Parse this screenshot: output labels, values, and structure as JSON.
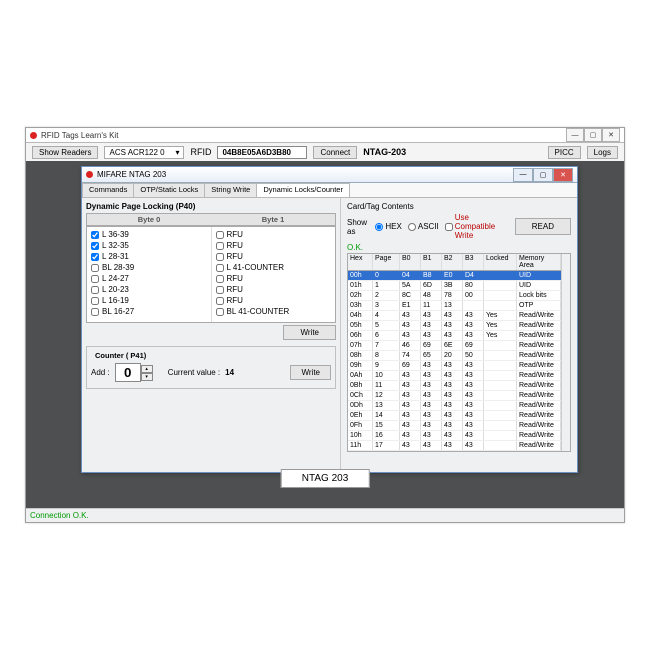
{
  "app": {
    "title": "RFID Tags Learn's Kit",
    "win_min": "—",
    "win_max": "▢",
    "win_close": "✕"
  },
  "toolbar": {
    "show_readers": "Show Readers",
    "reader_selected": "ACS ACR122 0",
    "rfid_label": "RFID",
    "rfid_value": "04B8E05A6D3B80",
    "connect": "Connect",
    "tag_name": "NTAG-203",
    "picc": "PICC",
    "logs": "Logs"
  },
  "canvas_label": "NTAG 203",
  "status": "Connection O.K.",
  "child": {
    "title": "MIFARE NTAG 203",
    "tabs": [
      "Commands",
      "OTP/Static Locks",
      "String Write",
      "Dynamic Locks/Counter"
    ],
    "active_tab": 3,
    "dpl_title": "Dynamic Page Locking (P40)",
    "byte0_label": "Byte 0",
    "byte1_label": "Byte 1",
    "byte0_items": [
      {
        "label": "L 36-39",
        "checked": true
      },
      {
        "label": "L 32-35",
        "checked": true
      },
      {
        "label": "L 28-31",
        "checked": true
      },
      {
        "label": "BL 28-39",
        "checked": false
      },
      {
        "label": "L 24-27",
        "checked": false
      },
      {
        "label": "L 20-23",
        "checked": false
      },
      {
        "label": "L 16-19",
        "checked": false
      },
      {
        "label": "BL 16-27",
        "checked": false
      }
    ],
    "byte1_items": [
      {
        "label": "RFU",
        "checked": false
      },
      {
        "label": "RFU",
        "checked": false
      },
      {
        "label": "RFU",
        "checked": false
      },
      {
        "label": "L 41-COUNTER",
        "checked": false
      },
      {
        "label": "RFU",
        "checked": false
      },
      {
        "label": "RFU",
        "checked": false
      },
      {
        "label": "RFU",
        "checked": false
      },
      {
        "label": "BL 41-COUNTER",
        "checked": false
      }
    ],
    "write": "Write",
    "counter": {
      "group": "Counter ( P41)",
      "add_label": "Add :",
      "add_value": "0",
      "cur_label": "Current value :",
      "cur_value": "14"
    },
    "contents_title": "Card/Tag Contents",
    "show_as": "Show as",
    "hex": "HEX",
    "ascii": "ASCII",
    "compat": "Use Compatible Write",
    "read": "READ",
    "ok": "O.K.",
    "grid_head": [
      "Hex",
      "Page",
      "B0",
      "B1",
      "B2",
      "B3",
      "Locked",
      "Memory Area"
    ],
    "rows": [
      {
        "h": "00h",
        "p": "0",
        "b": [
          "04",
          "B8",
          "E0",
          "D4"
        ],
        "l": "",
        "m": "UID",
        "sel": true
      },
      {
        "h": "01h",
        "p": "1",
        "b": [
          "5A",
          "6D",
          "3B",
          "80"
        ],
        "l": "",
        "m": "UID"
      },
      {
        "h": "02h",
        "p": "2",
        "b": [
          "8C",
          "48",
          "78",
          "00"
        ],
        "l": "",
        "m": "Lock bits"
      },
      {
        "h": "03h",
        "p": "3",
        "b": [
          "E1",
          "11",
          "13",
          ""
        ],
        "l": "",
        "m": "OTP"
      },
      {
        "h": "04h",
        "p": "4",
        "b": [
          "43",
          "43",
          "43",
          "43"
        ],
        "l": "Yes",
        "m": "Read/Write"
      },
      {
        "h": "05h",
        "p": "5",
        "b": [
          "43",
          "43",
          "43",
          "43"
        ],
        "l": "Yes",
        "m": "Read/Write"
      },
      {
        "h": "06h",
        "p": "6",
        "b": [
          "43",
          "43",
          "43",
          "43"
        ],
        "l": "Yes",
        "m": "Read/Write"
      },
      {
        "h": "07h",
        "p": "7",
        "b": [
          "46",
          "69",
          "6E",
          "69"
        ],
        "l": "",
        "m": "Read/Write"
      },
      {
        "h": "08h",
        "p": "8",
        "b": [
          "74",
          "65",
          "20",
          "50"
        ],
        "l": "",
        "m": "Read/Write"
      },
      {
        "h": "09h",
        "p": "9",
        "b": [
          "69",
          "43",
          "43",
          "43"
        ],
        "l": "",
        "m": "Read/Write"
      },
      {
        "h": "0Ah",
        "p": "10",
        "b": [
          "43",
          "43",
          "43",
          "43"
        ],
        "l": "",
        "m": "Read/Write"
      },
      {
        "h": "0Bh",
        "p": "11",
        "b": [
          "43",
          "43",
          "43",
          "43"
        ],
        "l": "",
        "m": "Read/Write"
      },
      {
        "h": "0Ch",
        "p": "12",
        "b": [
          "43",
          "43",
          "43",
          "43"
        ],
        "l": "",
        "m": "Read/Write"
      },
      {
        "h": "0Dh",
        "p": "13",
        "b": [
          "43",
          "43",
          "43",
          "43"
        ],
        "l": "",
        "m": "Read/Write"
      },
      {
        "h": "0Eh",
        "p": "14",
        "b": [
          "43",
          "43",
          "43",
          "43"
        ],
        "l": "",
        "m": "Read/Write"
      },
      {
        "h": "0Fh",
        "p": "15",
        "b": [
          "43",
          "43",
          "43",
          "43"
        ],
        "l": "",
        "m": "Read/Write"
      },
      {
        "h": "10h",
        "p": "16",
        "b": [
          "43",
          "43",
          "43",
          "43"
        ],
        "l": "",
        "m": "Read/Write"
      },
      {
        "h": "11h",
        "p": "17",
        "b": [
          "43",
          "43",
          "43",
          "43"
        ],
        "l": "",
        "m": "Read/Write"
      }
    ]
  }
}
